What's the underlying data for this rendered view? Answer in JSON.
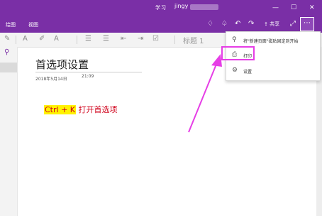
{
  "window": {
    "title": "学习",
    "user": "jingy",
    "minimize": "—",
    "maximize": "☐",
    "close": "✕"
  },
  "ribbon": {
    "tabs": [
      "绘图",
      "视图"
    ],
    "share_label": "共享",
    "more_label": "⋯"
  },
  "toolbar": {
    "heading_style": "标题 1"
  },
  "page": {
    "title": "首选项设置",
    "date": "2018年5月14日",
    "time": "21:09",
    "hint_key": "Ctrl + K",
    "hint_text": " 打开首选项"
  },
  "menu": {
    "items": [
      {
        "icon": "pin-icon",
        "label": "将\"新建页面\"磁贴固定到开始"
      },
      {
        "icon": "printer-icon",
        "label": "打印"
      },
      {
        "icon": "gear-icon",
        "label": "设置"
      }
    ]
  },
  "colors": {
    "accent": "#7a2fa6",
    "annotation": "#e63ee6",
    "hint_text": "#d0021b",
    "hint_highlight": "#fff200"
  }
}
